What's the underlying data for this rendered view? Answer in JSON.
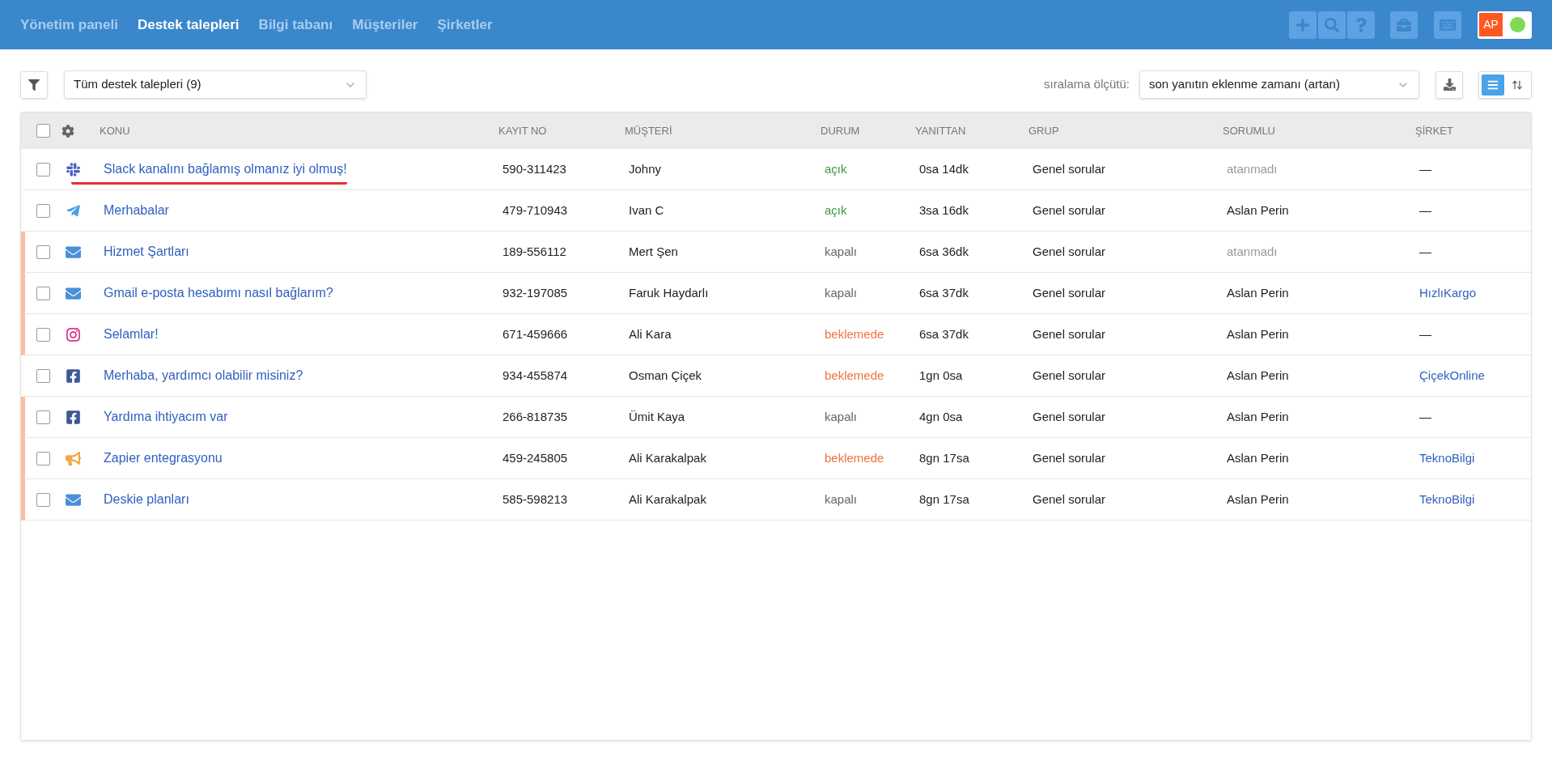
{
  "nav": [
    {
      "label": "Yönetim paneli",
      "selected": false
    },
    {
      "label": "Destek talepleri",
      "selected": true
    },
    {
      "label": "Bilgi tabanı",
      "selected": false
    },
    {
      "label": "Müşteriler",
      "selected": false
    },
    {
      "label": "Şirketler",
      "selected": false
    }
  ],
  "user": {
    "initials": "AP",
    "online": true
  },
  "filter": {
    "value": "Tüm destek talepleri (9)"
  },
  "sort": {
    "label": "sıralama ölçütü:",
    "value": "son yanıtın eklenme zamanı (artan)"
  },
  "view_modes": [
    {
      "kind": "list",
      "selected": true
    },
    {
      "kind": "compact",
      "selected": false
    }
  ],
  "select_all": {
    "checked": false
  },
  "columns": [
    "KONU",
    "KAYIT NO",
    "MÜŞTERİ",
    "DURUM",
    "YANITTAN",
    "GRUP",
    "SORUMLU",
    "ŞİRKET"
  ],
  "rows": [
    {
      "kind": "slack",
      "subject": "Slack kanalını bağlamış olmanız iyi olmuş!",
      "id": "590-311423",
      "customer": "Johny",
      "status": {
        "text": "açık",
        "color": "#3c9a3c"
      },
      "age": "0sa 14dk",
      "group": "Genel sorular",
      "assignee": "atanmadı",
      "assigned": false,
      "company": "—",
      "company_link": false,
      "flagged": false,
      "focused": true,
      "checked": false
    },
    {
      "kind": "telegram",
      "subject": "Merhabalar",
      "id": "479-710943",
      "customer": "Ivan C",
      "status": {
        "text": "açık",
        "color": "#3c9a3c"
      },
      "age": "3sa 16dk",
      "group": "Genel sorular",
      "assignee": "Aslan Perin",
      "assigned": true,
      "company": "—",
      "company_link": false,
      "flagged": false,
      "focused": false,
      "checked": false
    },
    {
      "kind": "email",
      "subject": "Hizmet Şartları",
      "id": "189-556112",
      "customer": "Mert Şen",
      "status": {
        "text": "kapalı",
        "color": "#666666"
      },
      "age": "6sa 36dk",
      "group": "Genel sorular",
      "assignee": "atanmadı",
      "assigned": false,
      "company": "—",
      "company_link": false,
      "flagged": true,
      "focused": false,
      "checked": false
    },
    {
      "kind": "email",
      "subject": "Gmail e-posta hesabımı nasıl bağlarım?",
      "id": "932-197085",
      "customer": "Faruk Haydarlı",
      "status": {
        "text": "kapalı",
        "color": "#666666"
      },
      "age": "6sa 37dk",
      "group": "Genel sorular",
      "assignee": "Aslan Perin",
      "assigned": true,
      "company": "HızlıKargo",
      "company_link": true,
      "flagged": true,
      "focused": false,
      "checked": false
    },
    {
      "kind": "instagram",
      "subject": "Selamlar!",
      "id": "671-459666",
      "customer": "Ali Kara",
      "status": {
        "text": "beklemede",
        "color": "#f0743e"
      },
      "age": "6sa 37dk",
      "group": "Genel sorular",
      "assignee": "Aslan Perin",
      "assigned": true,
      "company": "—",
      "company_link": false,
      "flagged": true,
      "focused": false,
      "checked": false
    },
    {
      "kind": "facebook",
      "subject": "Merhaba, yardımcı olabilir misiniz?",
      "id": "934-455874",
      "customer": "Osman Çiçek",
      "status": {
        "text": "beklemede",
        "color": "#f0743e"
      },
      "age": "1gn 0sa",
      "group": "Genel sorular",
      "assignee": "Aslan Perin",
      "assigned": true,
      "company": "ÇiçekOnline",
      "company_link": true,
      "flagged": false,
      "focused": false,
      "checked": false
    },
    {
      "kind": "facebook",
      "subject": "Yardıma ihtiyacım var",
      "id": "266-818735",
      "customer": "Ümit Kaya",
      "status": {
        "text": "kapalı",
        "color": "#666666"
      },
      "age": "4gn 0sa",
      "group": "Genel sorular",
      "assignee": "Aslan Perin",
      "assigned": true,
      "company": "—",
      "company_link": false,
      "flagged": true,
      "focused": false,
      "checked": false
    },
    {
      "kind": "megaphone",
      "subject": "Zapier entegrasyonu",
      "id": "459-245805",
      "customer": "Ali Karakalpak",
      "status": {
        "text": "beklemede",
        "color": "#f0743e"
      },
      "age": "8gn 17sa",
      "group": "Genel sorular",
      "assignee": "Aslan Perin",
      "assigned": true,
      "company": "TeknoBilgi",
      "company_link": true,
      "flagged": true,
      "focused": false,
      "checked": false
    },
    {
      "kind": "email",
      "subject": "Deskie planları",
      "id": "585-598213",
      "customer": "Ali Karakalpak",
      "status": {
        "text": "kapalı",
        "color": "#666666"
      },
      "age": "8gn 17sa",
      "group": "Genel sorular",
      "assignee": "Aslan Perin",
      "assigned": true,
      "company": "TeknoBilgi",
      "company_link": true,
      "flagged": true,
      "focused": false,
      "checked": false
    }
  ]
}
